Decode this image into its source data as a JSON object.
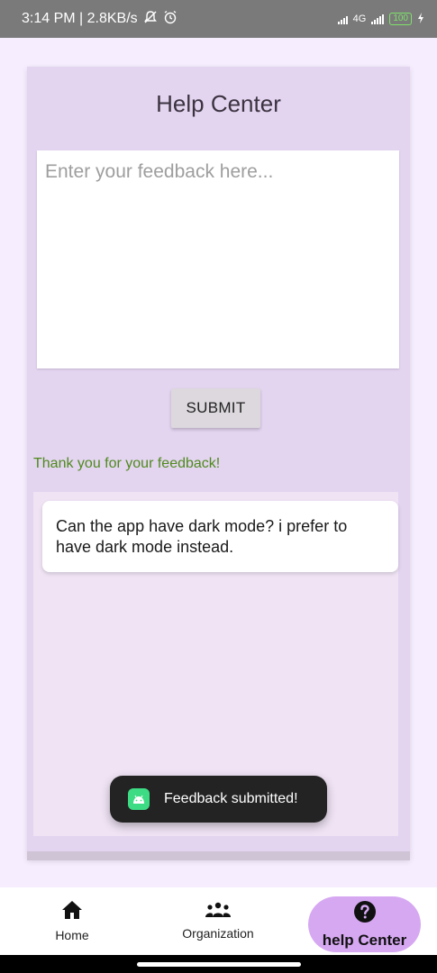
{
  "status_bar": {
    "time_speed": "3:14 PM | 2.8KB/s",
    "network_label": "4G",
    "battery": "100"
  },
  "help_center": {
    "title": "Help Center",
    "feedback_placeholder": "Enter your feedback here...",
    "submit_label": "SUBMIT",
    "thanks_message": "Thank you for your feedback!",
    "feedback_items": [
      {
        "text": "Can the app have dark mode? i prefer to have dark mode instead."
      }
    ]
  },
  "toast": {
    "message": "Feedback submitted!"
  },
  "bottom_nav": {
    "items": [
      {
        "label": "Home",
        "icon": "home-icon"
      },
      {
        "label": "Organization",
        "icon": "people-icon"
      },
      {
        "label": "help Center",
        "icon": "help-icon",
        "active": true
      }
    ]
  },
  "colors": {
    "accent": "#d6a8f2",
    "page_background": "#f6eefe",
    "success_text": "#4f8a1c"
  }
}
